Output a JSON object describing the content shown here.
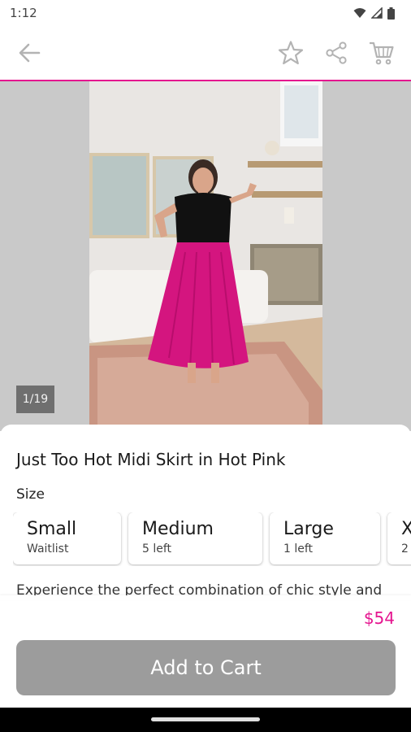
{
  "status_bar": {
    "time": "1:12",
    "icons": [
      "wifi-icon",
      "cell-signal-icon",
      "battery-icon"
    ]
  },
  "app_bar": {
    "back_icon": "arrow-left-icon",
    "actions": [
      "star-icon",
      "share-icon",
      "cart-icon"
    ]
  },
  "colors": {
    "accent": "#e5158f",
    "button_disabled": "#9c9c9c",
    "skirt": "#d4157f"
  },
  "gallery": {
    "counter": "1/19"
  },
  "product": {
    "title": "Just Too Hot Midi Skirt in Hot Pink",
    "size_label": "Size",
    "sizes": [
      {
        "name": "Small",
        "stock": "Waitlist"
      },
      {
        "name": "Medium",
        "stock": "5 left"
      },
      {
        "name": "Large",
        "stock": "1 left"
      },
      {
        "name": "X",
        "stock": "2"
      }
    ],
    "description": "Experience the perfect combination of chic style and",
    "price": "$54",
    "add_to_cart": "Add to Cart"
  }
}
